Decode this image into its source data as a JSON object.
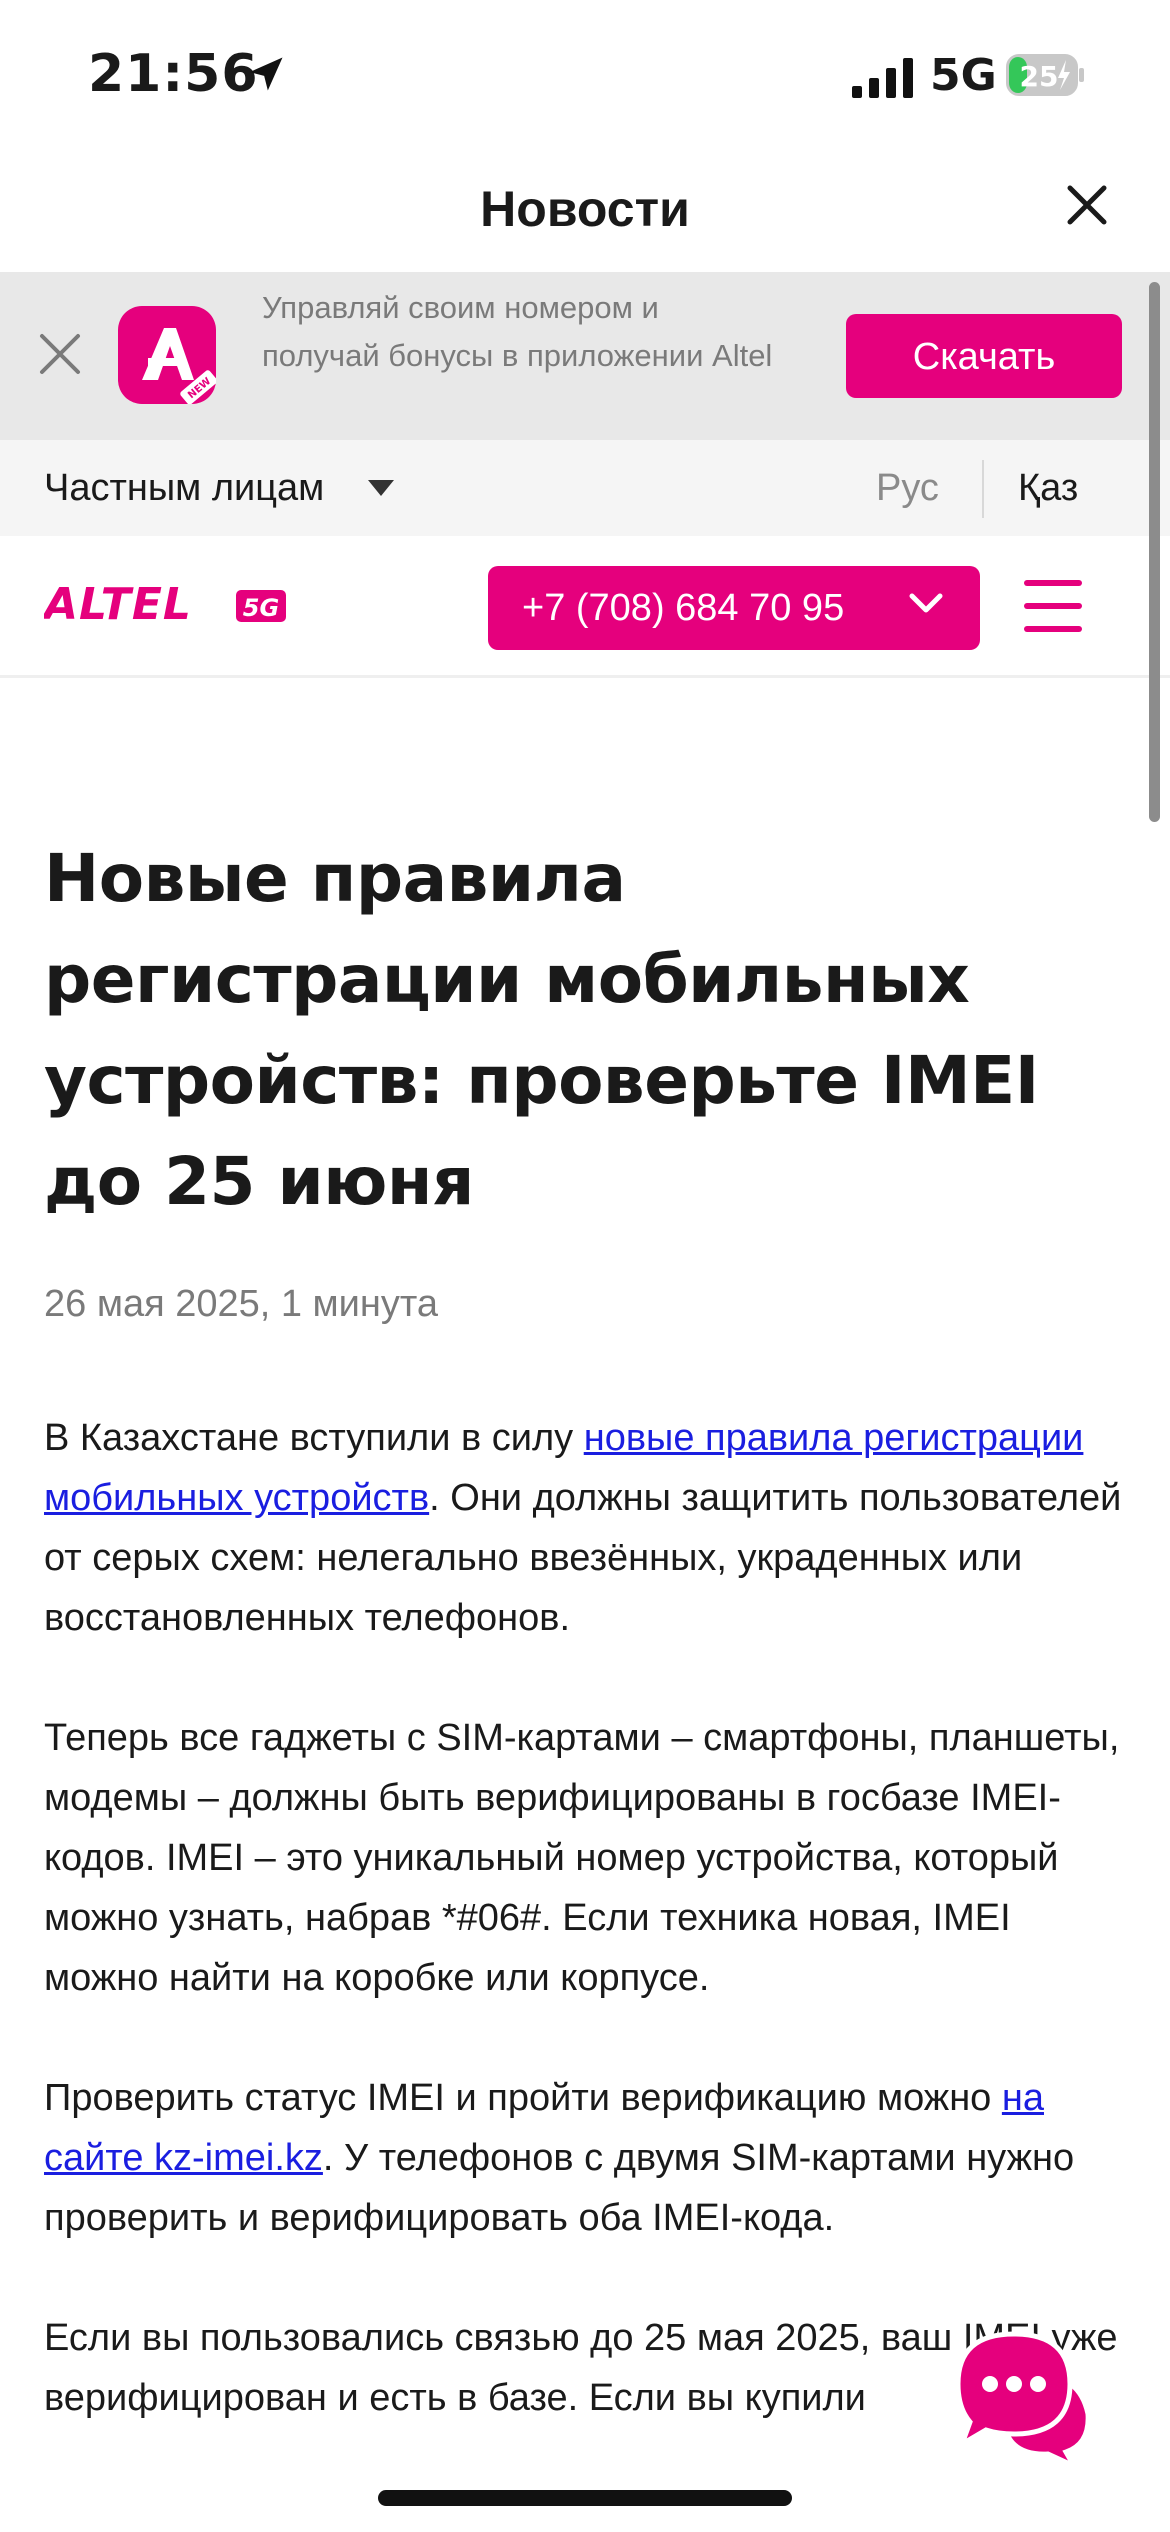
{
  "status_bar": {
    "time": "21:56",
    "network": "5G",
    "battery_level": "25"
  },
  "sheet": {
    "title": "Новости"
  },
  "app_banner": {
    "text": "Управляй своим номером и получай бонусы в приложении Altel",
    "download_label": "Скачать",
    "logo_badge": "NEW"
  },
  "segment_bar": {
    "segment_label": "Частным лицам",
    "lang_ru": "Рус",
    "lang_kz": "Қаз"
  },
  "site_header": {
    "brand": "ALTEL",
    "brand_badge": "5G",
    "phone_number": "+7 (708) 684 70 95"
  },
  "article": {
    "title": "Новые правила регистрации мобильных устройств: проверьте IMEI до 25 июня",
    "meta": "26 мая 2025, 1 минута",
    "p1_before": "В Казахстане вступили в силу ",
    "p1_link": "новые правила регистрации мобильных устройств",
    "p1_after": ". Они должны защитить пользователей от серых схем: нелегально ввезённых, украденных или восстановленных телефонов.",
    "p2": "Теперь все гаджеты с SIM-картами – смартфоны, планшеты, модемы – должны быть верифицированы в госбазе IMEI-кодов. IMEI – это уникальный номер устройства, который можно узнать, набрав *#06#. Если техника новая, IMEI можно найти на коробке или корпусе.",
    "p3_before": "Проверить статус IMEI и пройти верификацию можно ",
    "p3_link": "на сайте kz-imei.kz",
    "p3_after": ". У телефонов с двумя SIM-картами нужно проверить и верифицировать оба IMEI-кода.",
    "p4": "Если вы пользовались связью до 25 мая 2025, ваш IMEI уже верифицирован и есть в базе. Если вы купили"
  },
  "colors": {
    "brand_pink": "#e5007d",
    "link_blue": "#1a1ee0",
    "banner_bg": "#e8e8e8"
  }
}
